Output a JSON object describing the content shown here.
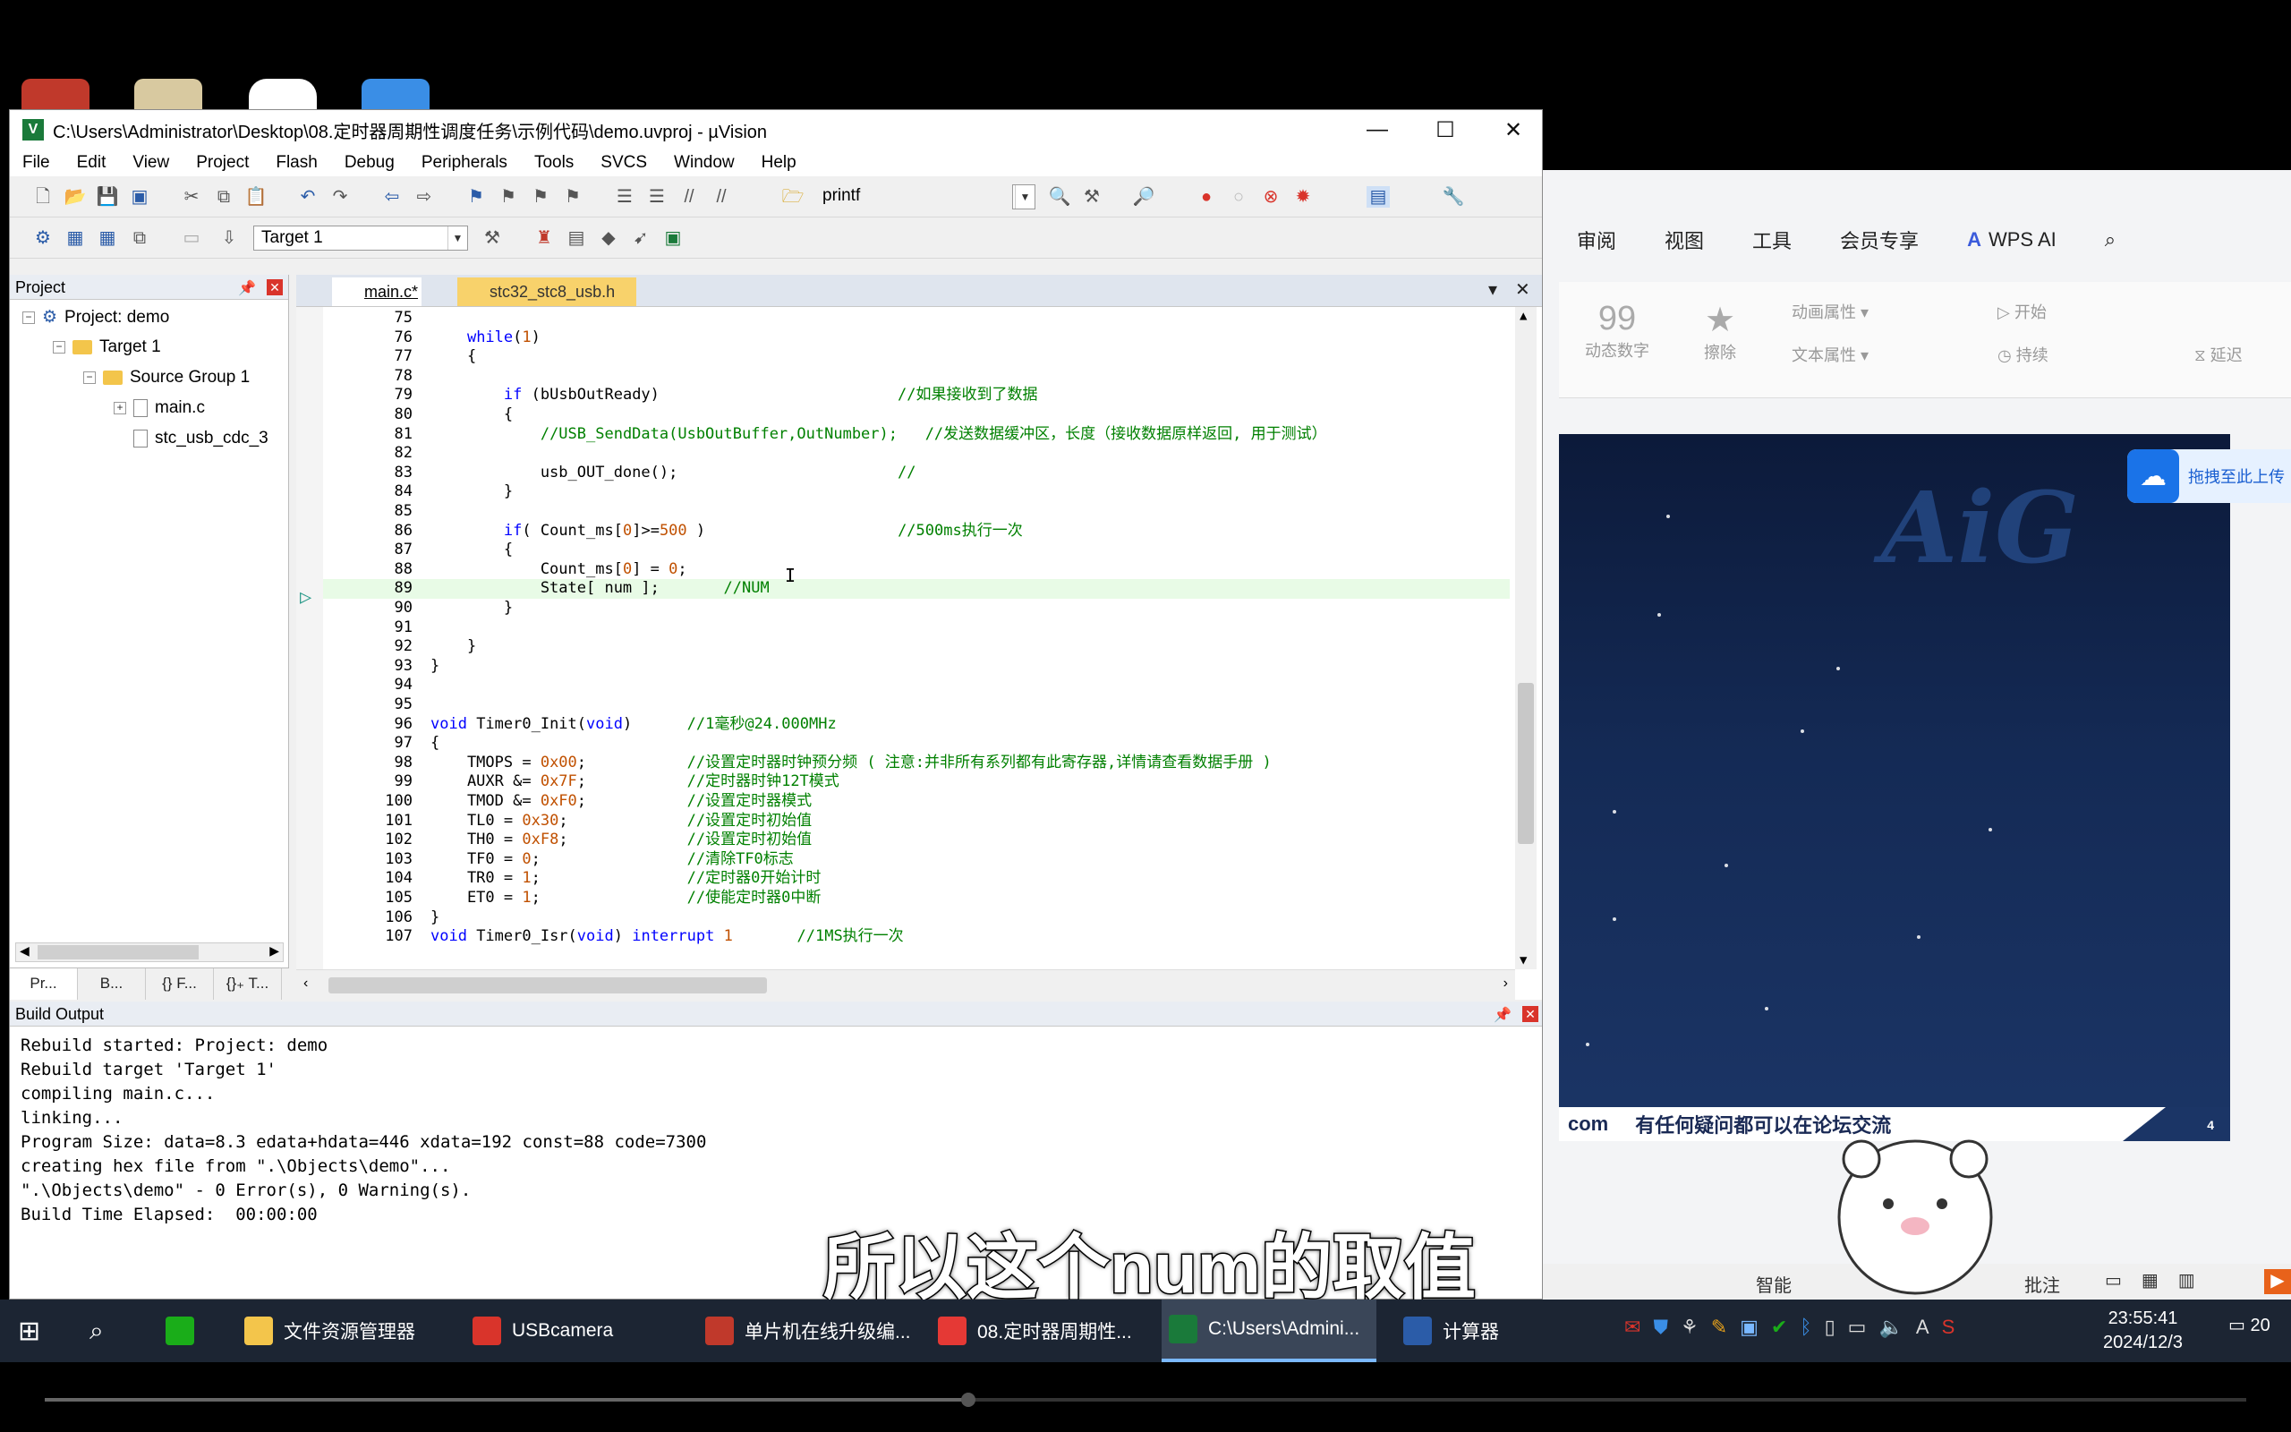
{
  "window": {
    "title": "C:\\Users\\Administrator\\Desktop\\08.定时器周期性调度任务\\示例代码\\demo.uvproj - µVision",
    "minimize": "—",
    "maximize": "☐",
    "close": "✕"
  },
  "menu": [
    "File",
    "Edit",
    "View",
    "Project",
    "Flash",
    "Debug",
    "Peripherals",
    "Tools",
    "SVCS",
    "Window",
    "Help"
  ],
  "toolbar": {
    "find_value": "printf",
    "target_value": "Target 1"
  },
  "project_panel": {
    "title": "Project",
    "tree": [
      {
        "label": "Project: demo",
        "level": 0
      },
      {
        "label": "Target 1",
        "level": 1
      },
      {
        "label": "Source Group 1",
        "level": 2
      },
      {
        "label": "main.c",
        "level": 3
      },
      {
        "label": "stc_usb_cdc_3",
        "level": 3
      }
    ],
    "tabs": [
      "Pr...",
      "B...",
      "{} F...",
      "{}₊ T..."
    ]
  },
  "editor": {
    "tabs": [
      "main.c*",
      "stc32_stc8_usb.h"
    ],
    "active_tab": "main.c*",
    "current_line": 89,
    "lines": [
      {
        "n": "75",
        "code": ""
      },
      {
        "n": "76",
        "code": "    while(1)"
      },
      {
        "n": "77",
        "code": "    {"
      },
      {
        "n": "78",
        "code": ""
      },
      {
        "n": "79",
        "code": "        if (bUsbOutReady)                          //如果接收到了数据"
      },
      {
        "n": "80",
        "code": "        {"
      },
      {
        "n": "81",
        "code": "            //USB_SendData(UsbOutBuffer,OutNumber);   //发送数据缓冲区，长度（接收数据原样返回, 用于测试）"
      },
      {
        "n": "82",
        "code": ""
      },
      {
        "n": "83",
        "code": "            usb_OUT_done();                        //"
      },
      {
        "n": "84",
        "code": "        }"
      },
      {
        "n": "85",
        "code": ""
      },
      {
        "n": "86",
        "code": "        if( Count_ms[0]>=500 )                     //500ms执行一次"
      },
      {
        "n": "87",
        "code": "        {"
      },
      {
        "n": "88",
        "code": "            Count_ms[0] = 0;"
      },
      {
        "n": "89",
        "code": "            State[ num ];       //NUM"
      },
      {
        "n": "90",
        "code": "        }"
      },
      {
        "n": "91",
        "code": ""
      },
      {
        "n": "92",
        "code": "    }"
      },
      {
        "n": "93",
        "code": "}"
      },
      {
        "n": "94",
        "code": ""
      },
      {
        "n": "95",
        "code": ""
      },
      {
        "n": "96",
        "code": "void Timer0_Init(void)      //1毫秒@24.000MHz"
      },
      {
        "n": "97",
        "code": "{"
      },
      {
        "n": "98",
        "code": "    TMOPS = 0x00;           //设置定时器时钟预分频 ( 注意:并非所有系列都有此寄存器,详情请查看数据手册 )"
      },
      {
        "n": "99",
        "code": "    AUXR &= 0x7F;           //定时器时钟12T模式"
      },
      {
        "n": "100",
        "code": "    TMOD &= 0xF0;           //设置定时器模式"
      },
      {
        "n": "101",
        "code": "    TL0 = 0x30;             //设置定时初始值"
      },
      {
        "n": "102",
        "code": "    TH0 = 0xF8;             //设置定时初始值"
      },
      {
        "n": "103",
        "code": "    TF0 = 0;                //清除TF0标志"
      },
      {
        "n": "104",
        "code": "    TR0 = 1;                //定时器0开始计时"
      },
      {
        "n": "105",
        "code": "    ET0 = 1;                //使能定时器0中断"
      },
      {
        "n": "106",
        "code": "}"
      },
      {
        "n": "107",
        "code": "void Timer0_Isr(void) interrupt 1       //1MS执行一次"
      }
    ]
  },
  "build_output": {
    "title": "Build Output",
    "lines": [
      "Rebuild started: Project: demo",
      "Rebuild target 'Target 1'",
      "compiling main.c...",
      "linking...",
      "Program Size: data=8.3 edata+hdata=446 xdata=192 const=88 code=7300",
      "creating hex file from \".\\Objects\\demo\"...",
      "\".\\Objects\\demo\" - 0 Error(s), 0 Warning(s).",
      "Build Time Elapsed:  00:00:00"
    ]
  },
  "wps": {
    "tabs": [
      "审阅",
      "视图",
      "工具",
      "会员专享",
      "WPS AI"
    ],
    "toolbar_labels": [
      "动态数字",
      "擦除",
      "动画属性",
      "文本属性",
      "开始",
      "持续",
      "延迟"
    ],
    "cloud_label": "拖拽至此上传",
    "slide_logo": "AiG",
    "footer_left": "com",
    "footer_text": "有任何疑问都可以在论坛交流",
    "page_number": "4",
    "status_items": [
      "智能",
      "批注"
    ]
  },
  "subtitle": "所以这个num的取值",
  "taskbar": {
    "buttons": [
      {
        "label": "文件资源管理器",
        "color": "#f3c54b"
      },
      {
        "label": "USBcamera",
        "color": "#d9342b"
      },
      {
        "label": "单片机在线升级编...",
        "color": "#c0392b"
      },
      {
        "label": "08.定时器周期性...",
        "color": "#e53935"
      },
      {
        "label": "C:\\Users\\Admini...",
        "color": "#1a7a3a"
      },
      {
        "label": "计算器",
        "color": "#2b5ca8"
      }
    ],
    "time": "23:55:41",
    "date": "2024/12/3",
    "notification_count": "20"
  }
}
